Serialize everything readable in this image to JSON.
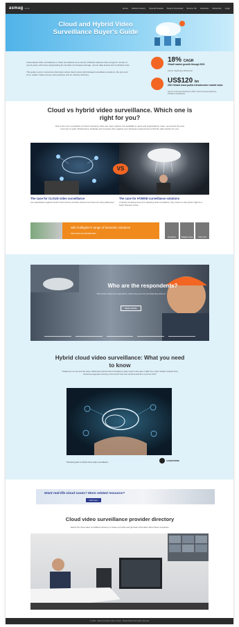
{
  "site": {
    "logo": "asmag",
    "logo_suffix": ".com",
    "nav": [
      "Home",
      "Global Industry",
      "Special Feature",
      "Report Download",
      "Secure UK",
      "Advertise",
      "Subscribe",
      "Login"
    ]
  },
  "hero": {
    "title": "Cloud and Hybrid Video Surveillance Buyer's Guide"
  },
  "intro": {
    "paragraphs": [
      "Cloud-based video surveillance or video surveillance as a service (VSaaS) solutions have surged in number in recent years, with users appreciating the benefits of increased storage, remote data access and controlled costs.",
      "This guide covers must-know information about cloud versus hybrid-based surveillance solutions, the pros and cons, reader market survey, best practices and an industry directory."
    ],
    "stats": [
      {
        "value": "18%",
        "suffix": "CAGR",
        "label": "VSaaS market growth through 2021",
        "source": "Source: Digital Eye Mechanism"
      },
      {
        "value": "US$120",
        "suffix": "bn",
        "label": "2021 Global cloud public infrastructure market value",
        "source": "Source: Forrester Predictions 2021, Cloud Computing Braves Pandemic Headwinds"
      }
    ]
  },
  "section_compare": {
    "title": "Cloud vs hybrid video surveillance. Which one is right for you?",
    "text": "Due to the rise in popularity of cloud computing, there are many options now available to users and organizations. Here, we present the pros and cons of each infrastructure. Evaluate and compare them against your business requirements to find the right solution for you.",
    "vs_label": "VS",
    "cloud": {
      "title": "The case for CLOUD video surveillance",
      "text": "Are organizations against cloud? Cloud service providers discuss how these are being addressed."
    },
    "hybrid": {
      "title": "The case for HYBRID surveillance solutions",
      "text": "If industry shopping came from adopting cloud surveillance, they reason to why hybrid might be a better business choice."
    }
  },
  "gallagher": {
    "headline": "with Gallagher's range of biometric solutions",
    "cta": "DISCOVER OUR BIOMETRICS",
    "tiles": [
      "Lift stations",
      "Gallagher Gates",
      "Other stuff"
    ]
  },
  "respondents": {
    "title": "Who are the respondents?",
    "subtitle": "This section shows the respondents, where they are from and what they work on",
    "button": "READ MORE"
  },
  "hybrid_need": {
    "title": "Hybrid cloud video surveillance: What you need to know",
    "text": "VSaaS are not one and the same. What does hybrid cloud surveillance really mean? How does it differ from other VSaaS models? How should we approach security in the cloud? And who would benefit the most from this?",
    "caption": "Practical guide to hybrid cloud video surveillance",
    "learn_more": "LEARN MORE"
  },
  "more_banner": {
    "title": "Want real-life cloud cases? More related resource?",
    "button": "Click here!"
  },
  "directory": {
    "title": "Cloud video surveillance provider directory",
    "text": "Search the cloud video surveillance directory to locate a provider and get basic information about these companies."
  },
  "footer": {
    "text": "© 2021 · Messe Frankfurt (HK) Limited · Taiwan Branch All rights reserved"
  },
  "colors": {
    "accent_orange": "#f26522",
    "hero_blue": "#4fb3e8",
    "light_band": "#dff1f9",
    "dark_nav": "#2b2b2b",
    "title_navy": "#2a3a8c"
  }
}
